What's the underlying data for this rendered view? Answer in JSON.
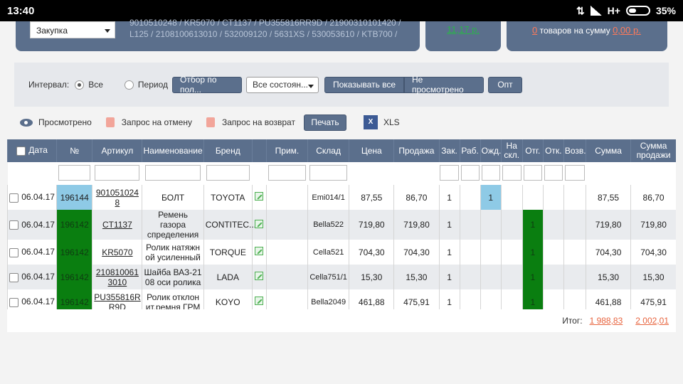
{
  "status": {
    "time": "13:40",
    "network": "H+",
    "battery": "35%"
  },
  "top": {
    "mode_select": "Закупка",
    "codes_line1": "9010510248 / KR5070 / CT1137 / PU355816RR9D / 21900310101420 /",
    "codes_line2": "L125 / 2108100613010 / 532009120 / 5631XS / 530053610 / KTB700 /",
    "amount": "11,17 р.",
    "cart_count": "0",
    "cart_text": "товаров на сумму",
    "cart_sum": "0,00 р."
  },
  "filter": {
    "interval_label": "Интервал:",
    "opt_all": "Все",
    "opt_period": "Период",
    "field_button": "Отбор по пол...",
    "state_select": "Все состоян...",
    "show_all": "Показывать все",
    "not_viewed": "Не просмотрено",
    "opt_button": "Опт"
  },
  "actions": {
    "viewed": "Просмотрено",
    "cancel_request": "Запрос на отмену",
    "return_request": "Запрос на возврат",
    "print": "Печать",
    "xls": "XLS",
    "xls_icon": "X"
  },
  "table": {
    "headers": [
      "Дата",
      "№",
      "Артикул",
      "Наименование",
      "Бренд",
      "",
      "Прим.",
      "Склад",
      "Цена",
      "Продажа",
      "Зак.",
      "Раб.",
      "Ожд.",
      "На скл.",
      "Отг.",
      "Отк.",
      "Возв.",
      "Сумма",
      "Сумма продажи"
    ],
    "rows": [
      {
        "date": "06.04.17",
        "num": "196144",
        "article": "901051024 8",
        "name": "БОЛТ",
        "brand": "TOYOTA",
        "note": "",
        "store": "Emi014/1",
        "price": "87,55",
        "sale": "86,70",
        "zak": "1",
        "rab": "",
        "ozh": "1",
        "nask": "",
        "otg": "",
        "otk": "",
        "vozv": "",
        "sum": "87,55",
        "sum_sale": "86,70"
      },
      {
        "date": "06.04.17",
        "num": "196142",
        "article": "CT1137",
        "name": "Ремень газора спределения",
        "brand": "CONTITEC...",
        "note": "",
        "store": "Bella522",
        "price": "719,80",
        "sale": "719,80",
        "zak": "1",
        "rab": "",
        "ozh": "",
        "nask": "",
        "otg": "1",
        "otk": "",
        "vozv": "",
        "sum": "719,80",
        "sum_sale": "719,80"
      },
      {
        "date": "06.04.17",
        "num": "196142",
        "article": "KR5070",
        "name": "Ролик натяжн ой усиленный",
        "brand": "TORQUE",
        "note": "",
        "store": "Cella521",
        "price": "704,30",
        "sale": "704,30",
        "zak": "1",
        "rab": "",
        "ozh": "",
        "nask": "",
        "otg": "1",
        "otk": "",
        "vozv": "",
        "sum": "704,30",
        "sum_sale": "704,30"
      },
      {
        "date": "06.04.17",
        "num": "196142",
        "article": "210810061 3010",
        "name": "Шайба ВАЗ-21 08 оси ролика",
        "brand": "LADA",
        "note": "",
        "store": "Cella751/1",
        "price": "15,30",
        "sale": "15,30",
        "zak": "1",
        "rab": "",
        "ozh": "",
        "nask": "",
        "otg": "1",
        "otk": "",
        "vozv": "",
        "sum": "15,30",
        "sum_sale": "15,30"
      },
      {
        "date": "06.04.17",
        "num": "196142",
        "article": "PU355816R R9D",
        "name": "Ролик отклон ит.ремня ГРМ",
        "brand": "KOYO",
        "note": "",
        "store": "Bella2049",
        "price": "461,88",
        "sale": "475,91",
        "zak": "1",
        "rab": "",
        "ozh": "",
        "nask": "",
        "otg": "1",
        "otk": "",
        "vozv": "",
        "sum": "461,88",
        "sum_sale": "475,91"
      }
    ]
  },
  "totals": {
    "label": "Итог:",
    "sum": "1 988,83",
    "sum_sale": "2 002,01"
  },
  "colors": {
    "header": "#5b6f8c",
    "accent_green": "#0a7e10",
    "accent_blue": "#8ecae6",
    "link_red": "#e8643f"
  }
}
